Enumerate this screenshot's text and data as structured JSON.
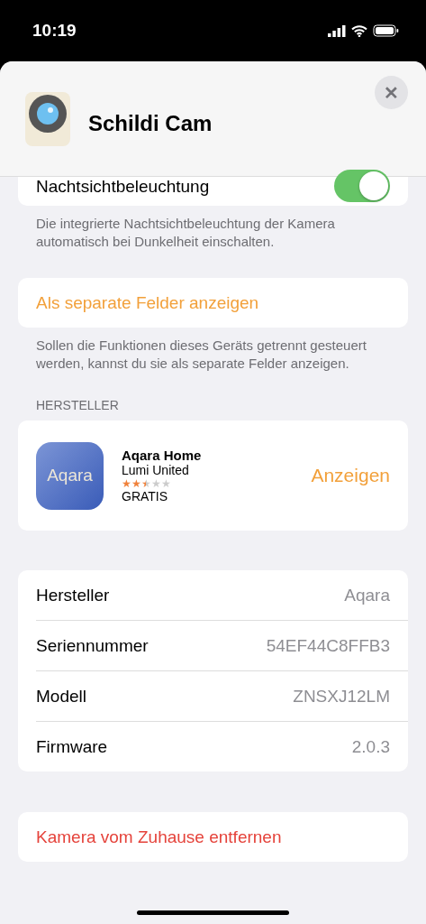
{
  "status_bar": {
    "time": "10:19"
  },
  "header": {
    "title": "Schildi Cam",
    "close_label": "✕"
  },
  "night_light": {
    "label": "Nachtsichtbeleuchtung",
    "on": true,
    "footer": "Die integrierte Nachtsichtbeleuchtung der Kamera automatisch bei Dunkelheit einschalten."
  },
  "separate": {
    "label": "Als separate Felder anzeigen",
    "footer": "Sollen die Funktionen dieses Geräts getrennt gesteuert werden, kannst du sie als separate Felder anzeigen."
  },
  "manufacturer_section": {
    "heading": "HERSTELLER",
    "app": {
      "icon_label": "Aqara",
      "name": "Aqara Home",
      "developer": "Lumi United",
      "stars": 2.5,
      "price": "GRATIS",
      "action": "Anzeigen"
    }
  },
  "info_rows": [
    {
      "label": "Hersteller",
      "value": "Aqara"
    },
    {
      "label": "Seriennummer",
      "value": "54EF44C8FFB3"
    },
    {
      "label": "Modell",
      "value": "ZNSXJ12LM"
    },
    {
      "label": "Firmware",
      "value": "2.0.3"
    }
  ],
  "remove_button": "Kamera vom Zuhause entfernen"
}
